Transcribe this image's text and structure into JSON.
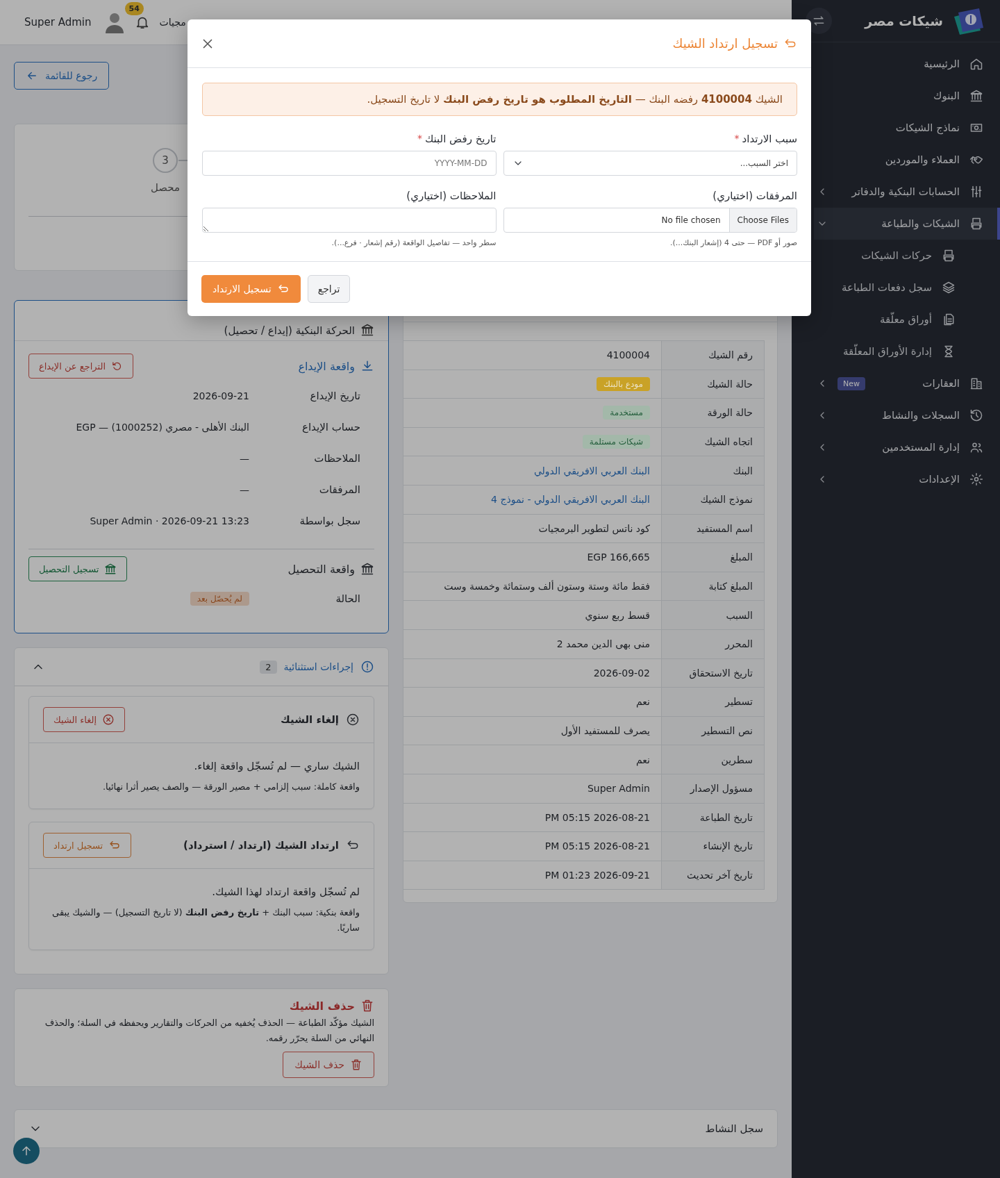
{
  "header": {
    "partial_title": "مجيات",
    "notification_count": "54",
    "user_name": "Super Admin"
  },
  "sidebar": {
    "brand": "شيكات مصر",
    "items": [
      {
        "kind": "link",
        "label": "الرئيسية",
        "selected": false
      },
      {
        "kind": "link",
        "label": "البنوك",
        "selected": false
      },
      {
        "kind": "link",
        "label": "نماذج الشيكات",
        "selected": false
      },
      {
        "kind": "link",
        "label": "العملاء والموردين",
        "selected": false
      },
      {
        "kind": "group",
        "label": "الحسابات البنكية والدفاتر",
        "selected": false,
        "expanded": false
      },
      {
        "kind": "group",
        "label": "الشيكات والطباعة",
        "selected": true,
        "expanded": true,
        "children": [
          {
            "label": "حركات الشيكات",
            "selected": false
          },
          {
            "label": "سجل دفعات الطباعة",
            "selected": false
          },
          {
            "label": "أوراق معلّقة",
            "selected": false
          },
          {
            "label": "إدارة الأوراق المعلّقة",
            "selected": false
          }
        ]
      },
      {
        "kind": "group",
        "label": "العقارات",
        "selected": false,
        "expanded": false,
        "badge": "New"
      },
      {
        "kind": "group",
        "label": "السجلات والنشاط",
        "selected": false,
        "expanded": false
      },
      {
        "kind": "group",
        "label": "إدارة المستخدمين",
        "selected": false,
        "expanded": false
      },
      {
        "kind": "group",
        "label": "الإعدادات",
        "selected": false,
        "expanded": false
      }
    ]
  },
  "back_button": "رجوع للقائمة",
  "stepper": {
    "steps": [
      {
        "number": "3",
        "label": "محصل"
      }
    ]
  },
  "bank_movement": {
    "title": "الحركة البنكية (إيداع / تحصيل)",
    "deposit": {
      "title": "واقعة الإيداع",
      "button": "التراجع عن الإيداع",
      "fields": [
        {
          "label": "تاريخ الإيداع",
          "value": "2026-09-21"
        },
        {
          "label": "حساب الإيداع",
          "value": "البنك الأهلى - مصري (1000252) — EGP"
        },
        {
          "label": "الملاحظات",
          "value": "—"
        },
        {
          "label": "المرفقات",
          "value": "—"
        },
        {
          "label": "سجل بواسطة",
          "value": "Super Admin · 2026-09-21 13:23"
        }
      ]
    },
    "collection": {
      "title": "واقعة التحصيل",
      "button": "تسجيل التحصيل",
      "fields": [
        {
          "label": "الحالة",
          "value": "لم يُحصّل بعد",
          "kind": "badge"
        }
      ]
    }
  },
  "exceptional": {
    "title": "إجراءات استثنائية",
    "count": "2",
    "expanded": true,
    "actions": [
      {
        "kind": "cancel",
        "title": "إلغاء الشيك",
        "button": "إلغاء الشيك",
        "status": "الشيك ساري — لم تُسجّل واقعة إلغاء.",
        "note": "واقعة كاملة: سبب إلزامي + مصير الورقة — والصف يصير أثرا نهائيا."
      },
      {
        "kind": "bounce",
        "title": "ارتداد الشيك (ارتداد / استرداد)",
        "button": "تسجيل ارتداد",
        "status": "لم تُسجّل واقعة ارتداد لهذا الشيك.",
        "note": "واقعة بنكية: سبب البنك + **تاريخ رفض البنك** (لا تاريخ التسجيل) — والشيك يبقى ساريًا."
      }
    ]
  },
  "delete": {
    "title": "حذف الشيك",
    "text": "الشيك مؤكّد الطباعة — الحذف يُخفيه من الحركات والتقارير ويحفظه في السلة؛ والحذف النهائي من السلة يحرّر رقمه.",
    "button": "حذف الشيك"
  },
  "details": {
    "rows": [
      {
        "label": "رقم الشيك",
        "value": "4100004",
        "kind": "text"
      },
      {
        "label": "حالة الشيك",
        "value": "مودع بالبنك",
        "kind": "badge_solid",
        "color": "#c9a227"
      },
      {
        "label": "حالة الورقة",
        "value": "مستخدمة",
        "kind": "badge_soft",
        "color": "#a3b8a9"
      },
      {
        "label": "اتجاه الشيك",
        "value": "شيكات مستلمة",
        "kind": "badge_soft",
        "color": "#a3b8a9"
      },
      {
        "label": "البنك",
        "value": "البنك العربي الافريقي الدولي",
        "kind": "link"
      },
      {
        "label": "نموذج الشيك",
        "value": "البنك العربي الافريقي الدولي - نموذج 4",
        "kind": "link"
      },
      {
        "label": "اسم المستفيد",
        "value": "كود ناتس لتطوير البرمجيات",
        "kind": "text"
      },
      {
        "label": "المبلغ",
        "value": "EGP 166,665",
        "kind": "text"
      },
      {
        "label": "المبلغ كتابة",
        "value": "فقط مائة وستة وستون ألف وستمائة وخمسة وست",
        "kind": "text"
      },
      {
        "label": "السبب",
        "value": "قسط ربع سنوي",
        "kind": "text"
      },
      {
        "label": "المحرر",
        "value": "منى بهى الدين محمد 2",
        "kind": "text"
      },
      {
        "label": "تاريخ الاستحقاق",
        "value": "2026-09-02",
        "kind": "text"
      },
      {
        "label": "تسطير",
        "value": "نعم",
        "kind": "text"
      },
      {
        "label": "نص التسطير",
        "value": "يصرف للمستفيد الأول",
        "kind": "text"
      },
      {
        "label": "سطرين",
        "value": "نعم",
        "kind": "text"
      },
      {
        "label": "مسؤول الإصدار",
        "value": "Super Admin",
        "kind": "text"
      },
      {
        "label": "تاريخ الطباعة",
        "value": "PM 05:15 2026-08-21",
        "kind": "text"
      },
      {
        "label": "تاريخ الإنشاء",
        "value": "PM 05:15 2026-08-21",
        "kind": "text"
      },
      {
        "label": "تاريخ آخر تحديث",
        "value": "PM 01:23 2026-09-21",
        "kind": "text"
      }
    ]
  },
  "activity": {
    "title": "سجل النشاط",
    "expanded": false
  },
  "modal": {
    "title": "تسجيل ارتداد الشيك",
    "alert": "الشيك **4100004** رفضه البنك — **التاريخ المطلوب هو تاريخ رفض البنك** لا تاريخ التسجيل.",
    "fields": [
      {
        "kind": "select",
        "label": "سبب الارتداد",
        "required_mark": "*",
        "placeholder": "اختر السبب..."
      },
      {
        "kind": "date",
        "label": "تاريخ رفض البنك",
        "required_mark": "*",
        "placeholder": "YYYY-MM-DD"
      },
      {
        "kind": "file",
        "label": "المرفقات (اختياري)",
        "button": "Choose Files",
        "value": "No file chosen",
        "hint": "صور أو PDF — حتى 4 (إشعار البنك...)."
      },
      {
        "kind": "textarea",
        "label": "الملاحظات (اختياري)",
        "hint": "سطر واحد — تفاصيل الواقعة (رقم إشعار · فرع...)."
      }
    ],
    "submit": "تسجيل الارتداد",
    "cancel": "تراجع"
  }
}
